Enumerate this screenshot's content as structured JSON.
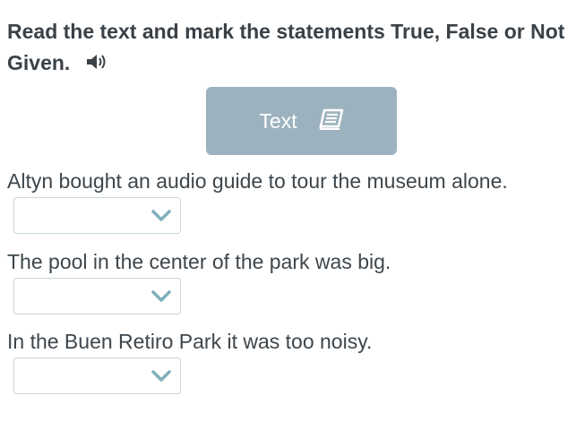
{
  "instruction": {
    "text": "Read the text and mark the statements True, False or Not Given.",
    "audio_icon": "speaker-icon"
  },
  "text_button": {
    "label": "Text",
    "icon": "book-icon"
  },
  "questions": [
    {
      "statement": "Altyn bought an audio guide to tour the museum alone.",
      "selected": ""
    },
    {
      "statement": "The pool in the center of the park was big.",
      "selected": ""
    },
    {
      "statement": "In the Buen Retiro Park it was too noisy.",
      "selected": ""
    }
  ],
  "colors": {
    "button_bg": "#9db2bf",
    "dropdown_border": "#c7d6dd",
    "chevron": "#7fb0bd"
  }
}
